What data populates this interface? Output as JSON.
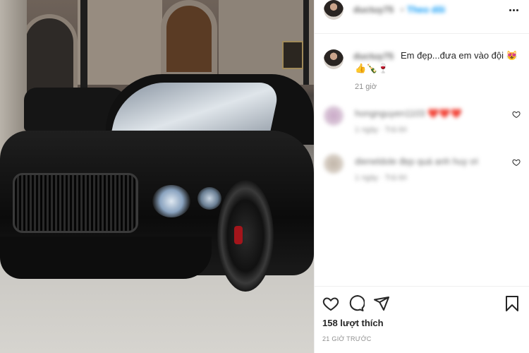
{
  "header": {
    "username": "ductuy75",
    "separator": "•",
    "follow_label": "Theo dõi",
    "more_icon": "more-horizontal-icon"
  },
  "caption": {
    "username": "ductuy75",
    "text": "Em đẹp...đưa em vào đội 😻",
    "emojis": "👍🍾🍷",
    "time": "21 giờ"
  },
  "comments": [
    {
      "username": "hongnguyen1103",
      "text": "❤️❤️❤️",
      "meta": "1 ngày · Trả lời"
    },
    {
      "username": "dieneldole",
      "text": "đẹp quá anh huy ơi",
      "meta": "1 ngày · Trả lời"
    }
  ],
  "footer": {
    "likes": "158 lượt thích",
    "post_time": "21 GIỜ TRƯỚC"
  },
  "colors": {
    "accent": "#0095f6",
    "text": "#262626",
    "muted": "#8e8e8e",
    "border": "#efefef"
  }
}
